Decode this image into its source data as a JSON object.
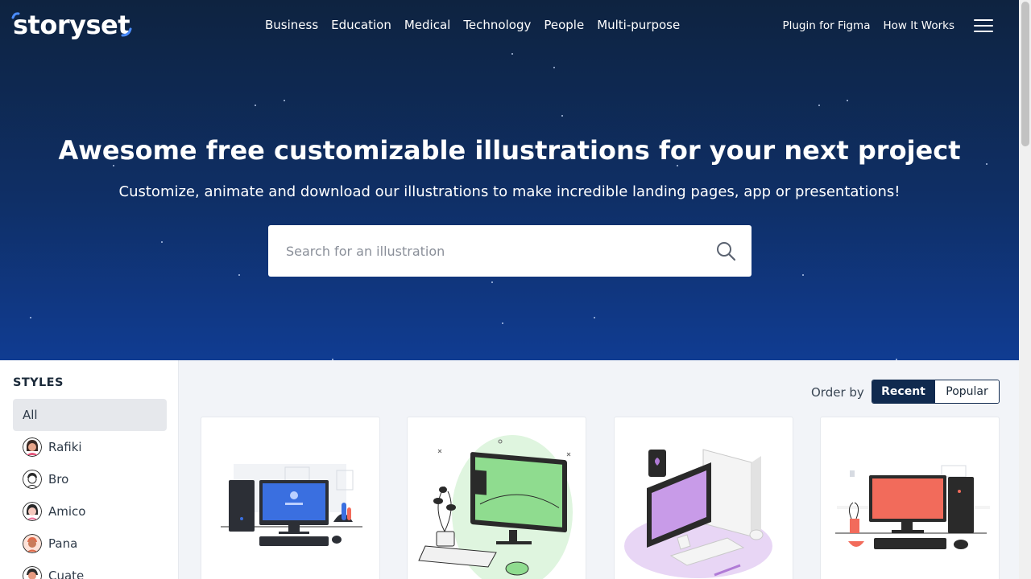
{
  "brand": {
    "logo_text": "storyset"
  },
  "nav": {
    "categories": [
      "Business",
      "Education",
      "Medical",
      "Technology",
      "People",
      "Multi-purpose"
    ],
    "right_links": [
      "Plugin for Figma",
      "How It Works"
    ]
  },
  "hero": {
    "title": "Awesome free customizable illustrations for your next project",
    "subtitle": "Customize, animate and download our illustrations to make incredible landing pages, app or presentations!",
    "search_placeholder": "Search for an illustration"
  },
  "sidebar": {
    "title": "STYLES",
    "items": [
      {
        "label": "All",
        "active": true
      },
      {
        "label": "Rafiki",
        "active": false
      },
      {
        "label": "Bro",
        "active": false
      },
      {
        "label": "Amico",
        "active": false
      },
      {
        "label": "Pana",
        "active": false
      },
      {
        "label": "Cuate",
        "active": false
      }
    ]
  },
  "order": {
    "label": "Order by",
    "options": [
      "Recent",
      "Popular"
    ],
    "selected": "Recent"
  },
  "cards": [
    {
      "icon": "computer-desk-illustration",
      "accent": "#3a6fe0"
    },
    {
      "icon": "monitor-plant-illustration",
      "accent": "#7ed47e"
    },
    {
      "icon": "purple-computer-illustration",
      "accent": "#b07bd6"
    },
    {
      "icon": "red-monitor-desk-illustration",
      "accent": "#f26b5b"
    }
  ],
  "colors": {
    "hero_top": "#0e2340",
    "hero_bottom": "#103c92",
    "primary_dark": "#102a4f"
  }
}
